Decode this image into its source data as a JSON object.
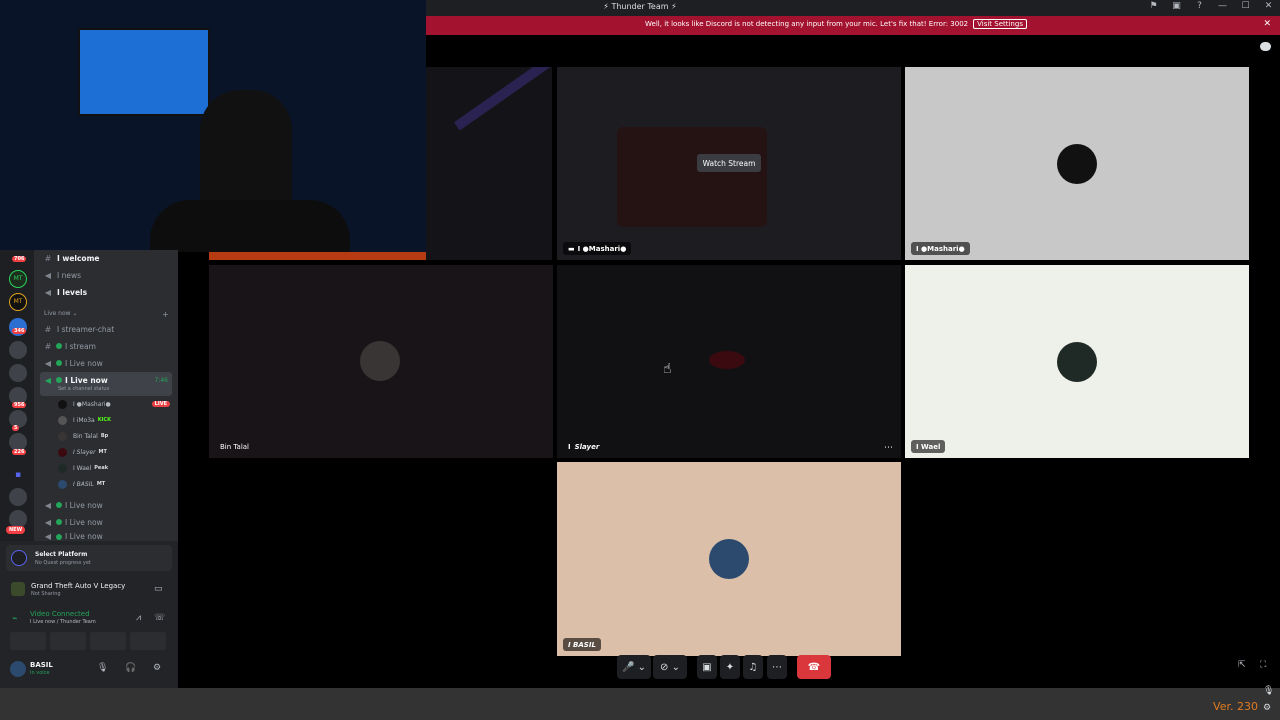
{
  "titlebar": {
    "title": "Thunder Team"
  },
  "banner": {
    "text": "Well, it looks like Discord is not detecting any input from your mic. Let's fix that!  Error: 3002",
    "button": "Visit Settings"
  },
  "rail": {
    "badges": [
      "706",
      "346",
      "956",
      "5",
      "226"
    ],
    "mt_label": "MT",
    "new_label": "NEW"
  },
  "channels": {
    "welcome": "I welcome",
    "news": "I news",
    "levels": "I levels",
    "category": "Live now ⌄",
    "streamer_chat": "I streamer-chat",
    "stream": "I stream",
    "live_now": "I Live now",
    "active_channel": "I Live now",
    "active_time": "7:46",
    "status_hint": "Set a channel status",
    "live_now_2": "I Live now",
    "live_now_3": "I Live now",
    "live_now_4": "I Live now"
  },
  "voice_users": [
    {
      "name": "I ●Mashari●",
      "tag": "LIVE"
    },
    {
      "name": "I iMo3a",
      "tag": "KICK"
    },
    {
      "name": "Bin Talal",
      "tag": "Bp"
    },
    {
      "name": "I Slayer",
      "tag": "MT"
    },
    {
      "name": "I Wael",
      "tag": "Peak"
    },
    {
      "name": "I BASIL",
      "tag": "MT"
    }
  ],
  "panel": {
    "quest_title": "Select Platform",
    "quest_sub": "No Quest progress yet",
    "game_title": "Grand Theft Auto V Legacy",
    "game_sub": "Not Sharing",
    "video_status": "Video Connected",
    "video_channel": "I Live now / Thunder Team",
    "username": "BASIL",
    "user_status": "In voice"
  },
  "tiles": {
    "watch_stream": "Watch Stream",
    "mashari_stream": "I ●Mashari●",
    "mashari": "I ●Mashari●",
    "bin_talal": "Bin Talal",
    "slayer": "Slayer",
    "slayer_prefix": "I",
    "wael": "I Wael",
    "basil": "I BASIL"
  },
  "footer": {
    "version": "Ver. 230"
  },
  "colors": {
    "banner": "#a3122f",
    "hangup": "#da373c",
    "accent": "#23a55a",
    "version": "#e07a1f"
  }
}
